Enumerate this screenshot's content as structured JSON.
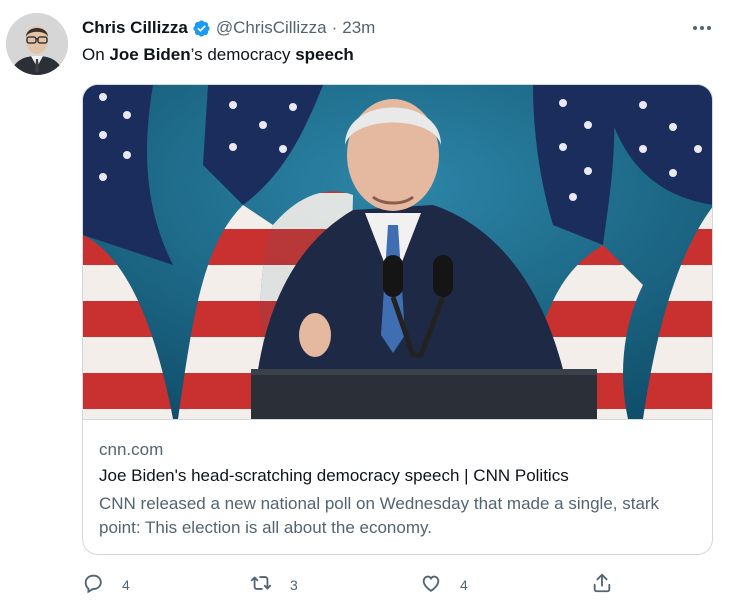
{
  "tweet": {
    "author_name": "Chris Cillizza",
    "handle": "@ChrisCillizza",
    "separator": "·",
    "time": "23m",
    "text_parts": [
      "On ",
      "Joe Biden",
      "’s democracy ",
      "speech"
    ]
  },
  "card": {
    "domain": "cnn.com",
    "title": "Joe Biden's head-scratching democracy speech | CNN Politics",
    "description": "CNN released a new national poll on Wednesday that made a single, stark point: This election is all about the economy."
  },
  "actions": {
    "replies": "4",
    "retweets": "3",
    "likes": "4"
  },
  "colors": {
    "verified_blue": "#1d9bf0",
    "secondary_text": "#536471",
    "border": "#cfd9de"
  },
  "icons": [
    "verified-badge-icon",
    "more-icon",
    "reply-icon",
    "retweet-icon",
    "like-icon",
    "share-icon"
  ]
}
